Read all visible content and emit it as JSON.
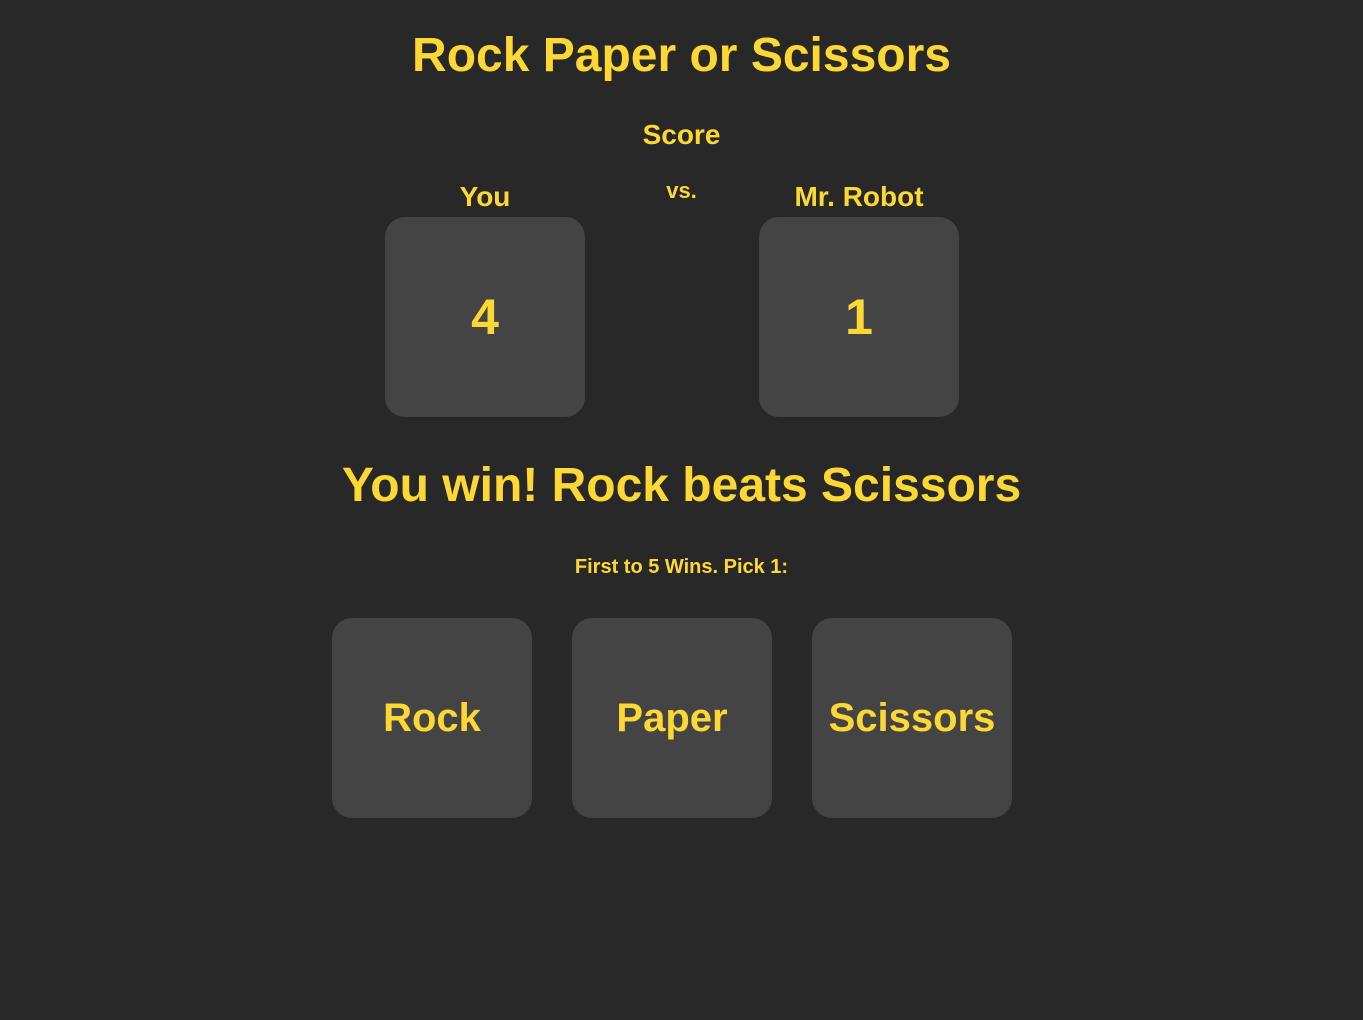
{
  "title": "Rock Paper or Scissors",
  "score": {
    "heading": "Score",
    "vs_label": "vs.",
    "player": {
      "label": "You",
      "value": "4"
    },
    "computer": {
      "label": "Mr. Robot",
      "value": "1"
    }
  },
  "result_message": "You win! Rock beats Scissors",
  "instructions": "First to 5 Wins. Pick 1:",
  "choices": {
    "rock": "Rock",
    "paper": "Paper",
    "scissors": "Scissors"
  },
  "colors": {
    "background": "#282828",
    "panel": "#444444",
    "accent_text": "#fdd835"
  }
}
